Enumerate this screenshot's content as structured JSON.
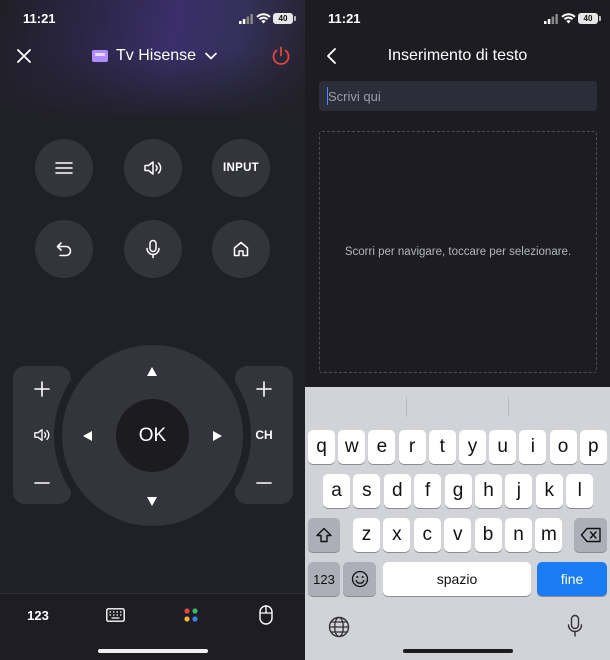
{
  "left": {
    "status": {
      "time": "11:21",
      "battery": "40"
    },
    "header": {
      "device_name": "Tv Hisense",
      "power_color": "#e8453c"
    },
    "buttons": {
      "input_label": "INPUT"
    },
    "dpad": {
      "ok_label": "OK"
    },
    "channel": {
      "label": "CH"
    },
    "bottom": {
      "numpad_label": "123",
      "dot_colors": [
        "#e8453c",
        "#3db86b",
        "#f2b233",
        "#3b7cf0"
      ]
    }
  },
  "right": {
    "status": {
      "time": "11:21",
      "battery": "40"
    },
    "title": "Inserimento di testo",
    "input": {
      "placeholder": "Scrivi qui",
      "value": ""
    },
    "touchpad_hint": "Scorri per navigare, toccare per selezionare.",
    "keyboard": {
      "row1": [
        "q",
        "w",
        "e",
        "r",
        "t",
        "y",
        "u",
        "i",
        "o",
        "p"
      ],
      "row2": [
        "a",
        "s",
        "d",
        "f",
        "g",
        "h",
        "j",
        "k",
        "l"
      ],
      "row3": [
        "z",
        "x",
        "c",
        "v",
        "b",
        "n",
        "m"
      ],
      "numbers_label": "123",
      "space_label": "spazio",
      "return_label": "fine",
      "return_color": "#1a7cf5"
    }
  }
}
